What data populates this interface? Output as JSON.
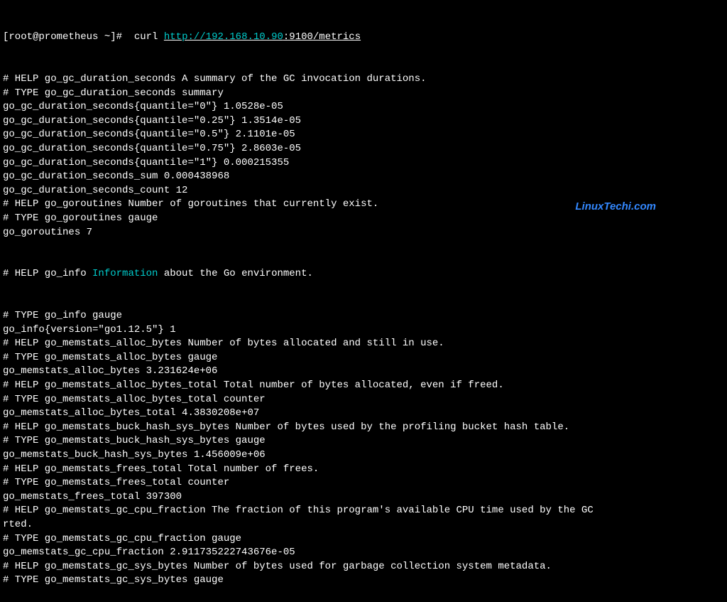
{
  "prompt": {
    "user_host": "[root@prometheus ~]#  ",
    "command": "curl ",
    "url_scheme": "http://192.168.10.90",
    "url_rest": ":9100/metrics"
  },
  "watermark": "LinuxTechi.com",
  "lines": [
    "# HELP go_gc_duration_seconds A summary of the GC invocation durations.",
    "# TYPE go_gc_duration_seconds summary",
    "go_gc_duration_seconds{quantile=\"0\"} 1.0528e-05",
    "go_gc_duration_seconds{quantile=\"0.25\"} 1.3514e-05",
    "go_gc_duration_seconds{quantile=\"0.5\"} 2.1101e-05",
    "go_gc_duration_seconds{quantile=\"0.75\"} 2.8603e-05",
    "go_gc_duration_seconds{quantile=\"1\"} 0.000215355",
    "go_gc_duration_seconds_sum 0.000438968",
    "go_gc_duration_seconds_count 12",
    "# HELP go_goroutines Number of goroutines that currently exist.",
    "# TYPE go_goroutines gauge",
    "go_goroutines 7"
  ],
  "info_line": {
    "prefix": "# HELP go_info ",
    "highlighted": "Information",
    "suffix": " about the Go environment."
  },
  "lines2": [
    "# TYPE go_info gauge",
    "go_info{version=\"go1.12.5\"} 1",
    "# HELP go_memstats_alloc_bytes Number of bytes allocated and still in use.",
    "# TYPE go_memstats_alloc_bytes gauge",
    "go_memstats_alloc_bytes 3.231624e+06",
    "# HELP go_memstats_alloc_bytes_total Total number of bytes allocated, even if freed.",
    "# TYPE go_memstats_alloc_bytes_total counter",
    "go_memstats_alloc_bytes_total 4.3830208e+07",
    "# HELP go_memstats_buck_hash_sys_bytes Number of bytes used by the profiling bucket hash table.",
    "# TYPE go_memstats_buck_hash_sys_bytes gauge",
    "go_memstats_buck_hash_sys_bytes 1.456009e+06",
    "# HELP go_memstats_frees_total Total number of frees.",
    "# TYPE go_memstats_frees_total counter",
    "go_memstats_frees_total 397300",
    "# HELP go_memstats_gc_cpu_fraction The fraction of this program's available CPU time used by the GC",
    "rted.",
    "# TYPE go_memstats_gc_cpu_fraction gauge",
    "go_memstats_gc_cpu_fraction 2.911735222743676e-05",
    "# HELP go_memstats_gc_sys_bytes Number of bytes used for garbage collection system metadata.",
    "# TYPE go_memstats_gc_sys_bytes gauge"
  ]
}
